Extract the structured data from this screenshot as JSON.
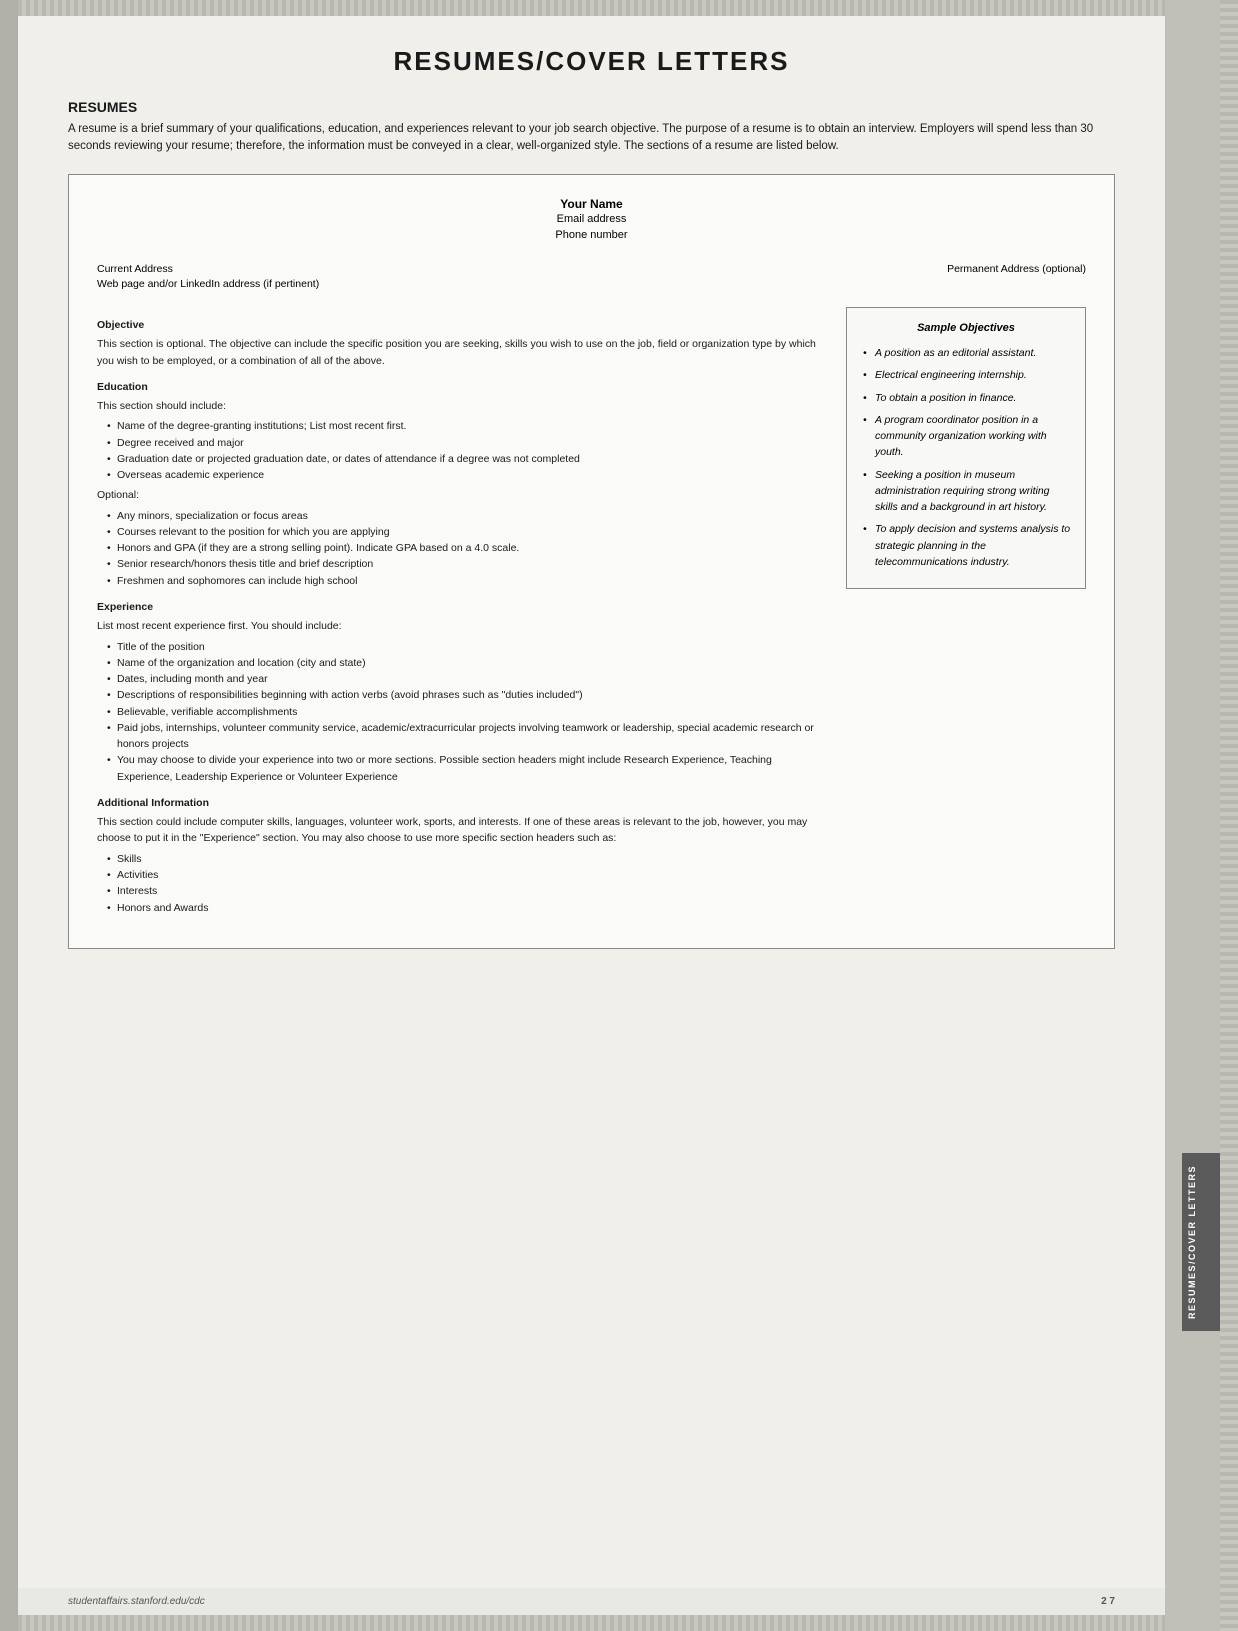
{
  "page": {
    "title": "RESUMES/COVER LETTERS",
    "footer_url": "studentaffairs.stanford.edu/cdc",
    "footer_page": "2  7"
  },
  "sidebar": {
    "tab_label": "RESUMES/COVER LETTERS"
  },
  "resumes_section": {
    "heading": "RESUMES",
    "intro": "A resume is a brief summary of your qualifications, education, and experiences relevant to your job search objective. The purpose of a resume is to obtain an interview. Employers will spend less than 30 seconds reviewing your resume; therefore, the information must be conveyed in a clear, well-organized style. The sections of a resume are listed below."
  },
  "resume_template": {
    "your_name": "Your Name",
    "email": "Email address",
    "phone": "Phone number",
    "current_address": "Current Address",
    "web_linkedin": "Web page and/or LinkedIn address (if pertinent)",
    "permanent_address": "Permanent Address (optional)"
  },
  "objective_section": {
    "title": "Objective",
    "text": "This section is optional. The objective can include the specific position you are seeking, skills you wish to use on the job, field or organization type by which you wish to be employed, or a combination of all of the above."
  },
  "sample_objectives": {
    "box_title": "Sample Objectives",
    "items": [
      "A position as an editorial assistant.",
      "Electrical engineering internship.",
      "To obtain a position in finance.",
      "A program coordinator position in a community organization working with youth.",
      "Seeking a position in museum administration requiring strong writing skills and a background in art history.",
      "To apply decision and systems analysis to strategic planning in the telecommunications industry."
    ]
  },
  "education_section": {
    "title": "Education",
    "intro": "This section should include:",
    "required_items": [
      "Name of the degree-granting institutions; List most recent first.",
      "Degree received and major",
      "Graduation date or projected graduation date, or dates of attendance if a degree was not completed",
      "Overseas academic experience"
    ],
    "optional_label": "Optional:",
    "optional_items": [
      "Any minors, specialization or focus areas",
      "Courses relevant to the position for which you are applying",
      "Honors and GPA (if they are a strong selling point). Indicate GPA based on a 4.0 scale.",
      "Senior research/honors thesis title and brief description",
      "Freshmen and sophomores can include high school"
    ]
  },
  "experience_section": {
    "title": "Experience",
    "intro": "List most recent experience first. You should include:",
    "items": [
      "Title of the position",
      "Name of the organization and location (city and state)",
      "Dates, including month and year",
      "Descriptions of responsibilities beginning with action verbs (avoid phrases such as \"duties included\")",
      "Believable, verifiable accomplishments",
      "Paid jobs, internships, volunteer community service, academic/extracurricular projects involving teamwork or leadership, special academic research or honors projects",
      "You may choose to divide your experience into two or more sections. Possible section headers might include Research Experience, Teaching Experience, Leadership Experience or Volunteer Experience"
    ]
  },
  "additional_section": {
    "title": "Additional Information",
    "text": "This section could include computer skills, languages, volunteer work, sports, and interests. If one of these areas is relevant to the job, however, you may choose to put it in the \"Experience\" section. You may also choose to use more specific section headers such as:",
    "items": [
      "Skills",
      "Activities",
      "Interests",
      "Honors and Awards"
    ]
  }
}
